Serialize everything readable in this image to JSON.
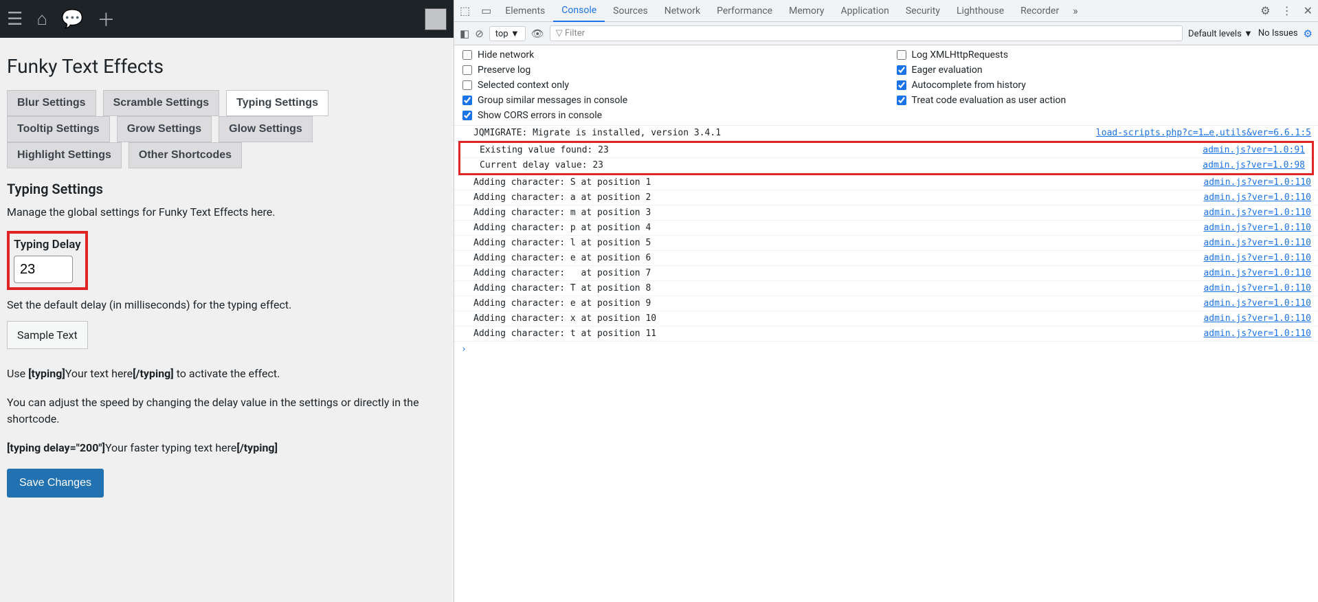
{
  "wp": {
    "title": "Funky Text Effects",
    "tabs": [
      "Blur Settings",
      "Scramble Settings",
      "Typing Settings",
      "Tooltip Settings",
      "Grow Settings",
      "Glow Settings",
      "Highlight Settings",
      "Other Shortcodes"
    ],
    "active_tab": "Typing Settings",
    "section_title": "Typing Settings",
    "desc": "Manage the global settings for Funky Text Effects here.",
    "field_label": "Typing Delay",
    "field_value": "23",
    "help": "Set the default delay (in milliseconds) for the typing effect.",
    "sample": "Sample Text",
    "usage_pre": "Use ",
    "usage_tag_open": "[typing]",
    "usage_mid": "Your text here",
    "usage_tag_close": "[/typing]",
    "usage_post": " to activate the effect.",
    "adjust": "You can adjust the speed by changing the delay value in the settings or directly in the shortcode.",
    "ex_tag_open": "[typing delay=\"200\"]",
    "ex_mid": "Your faster typing text here",
    "ex_tag_close": "[/typing]",
    "save": "Save Changes"
  },
  "devtools": {
    "tabs": [
      "Elements",
      "Console",
      "Sources",
      "Network",
      "Performance",
      "Memory",
      "Application",
      "Security",
      "Lighthouse",
      "Recorder"
    ],
    "active_tab": "Console",
    "context": "top",
    "filter_placeholder": "Filter",
    "levels": "Default levels",
    "issues": "No Issues",
    "checks": [
      {
        "label": "Hide network",
        "checked": false
      },
      {
        "label": "Log XMLHttpRequests",
        "checked": false
      },
      {
        "label": "Preserve log",
        "checked": false
      },
      {
        "label": "Eager evaluation",
        "checked": true
      },
      {
        "label": "Selected context only",
        "checked": false
      },
      {
        "label": "Autocomplete from history",
        "checked": true
      },
      {
        "label": "Group similar messages in console",
        "checked": true
      },
      {
        "label": "Treat code evaluation as user action",
        "checked": true
      },
      {
        "label": "Show CORS errors in console",
        "checked": true
      }
    ],
    "lines": [
      {
        "msg": "JQMIGRATE: Migrate is installed, version 3.4.1",
        "src": "load-scripts.php?c=1…e,utils&ver=6.6.1:5",
        "hl": false
      },
      {
        "msg": "Existing value found: 23",
        "src": "admin.js?ver=1.0:91",
        "hl": true
      },
      {
        "msg": "Current delay value: 23",
        "src": "admin.js?ver=1.0:98",
        "hl": true
      },
      {
        "msg": "Adding character: S at position 1",
        "src": "admin.js?ver=1.0:110",
        "hl": false
      },
      {
        "msg": "Adding character: a at position 2",
        "src": "admin.js?ver=1.0:110",
        "hl": false
      },
      {
        "msg": "Adding character: m at position 3",
        "src": "admin.js?ver=1.0:110",
        "hl": false
      },
      {
        "msg": "Adding character: p at position 4",
        "src": "admin.js?ver=1.0:110",
        "hl": false
      },
      {
        "msg": "Adding character: l at position 5",
        "src": "admin.js?ver=1.0:110",
        "hl": false
      },
      {
        "msg": "Adding character: e at position 6",
        "src": "admin.js?ver=1.0:110",
        "hl": false
      },
      {
        "msg": "Adding character:   at position 7",
        "src": "admin.js?ver=1.0:110",
        "hl": false
      },
      {
        "msg": "Adding character: T at position 8",
        "src": "admin.js?ver=1.0:110",
        "hl": false
      },
      {
        "msg": "Adding character: e at position 9",
        "src": "admin.js?ver=1.0:110",
        "hl": false
      },
      {
        "msg": "Adding character: x at position 10",
        "src": "admin.js?ver=1.0:110",
        "hl": false
      },
      {
        "msg": "Adding character: t at position 11",
        "src": "admin.js?ver=1.0:110",
        "hl": false
      }
    ]
  }
}
